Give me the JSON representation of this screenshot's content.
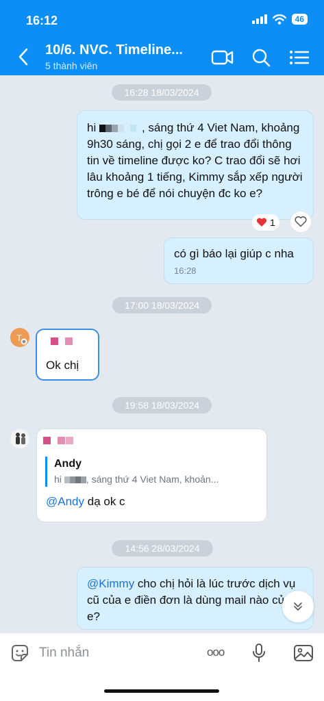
{
  "status": {
    "time": "16:12",
    "battery": "46"
  },
  "header": {
    "title": "10/6. NVC. Timeline...",
    "subtitle": "5 thành viên"
  },
  "messages": {
    "stamp1": "16:28 18/03/2024",
    "m1_pre": "hi ",
    "m1_mid": ", sáng thứ 4 Viet Nam,",
    "m1_rest": "khoảng 9h30 sáng, chị gọi 2 e để trao đổi thông tin về timeline được ko? C trao đổi sẽ hơi lâu khoảng 1 tiếng, Kimmy sắp xếp người trông e bé để nói chuyện đc ko e?",
    "m1_reaction_count": "1",
    "m2_text": "có gì báo lại giúp c nha",
    "m2_time": "16:28",
    "stamp2": "17:00 18/03/2024",
    "m3_text": "Ok chị",
    "stamp3": "19:58 18/03/2024",
    "m4_quote_author": "Andy",
    "m4_quote_pre": "hi ",
    "m4_quote_rest": ", sáng thứ 4 Viet Nam, khoản...",
    "m4_mention": "@Andy",
    "m4_text": " dạ ok c",
    "stamp4": "14:56 28/03/2024",
    "m5_mention": "@Kimmy",
    "m5_text": " cho chị hỏi là lúc trước dịch vụ cũ của e điền đơn là dùng mail nào của e?"
  },
  "composer": {
    "placeholder": "Tin nhắn",
    "more": "ooo"
  },
  "colors": {
    "header": "#0b8ff6",
    "chat_bg": "#e2e9f1",
    "my_bubble": "#d6f0ff",
    "mention": "#1a73d9"
  }
}
